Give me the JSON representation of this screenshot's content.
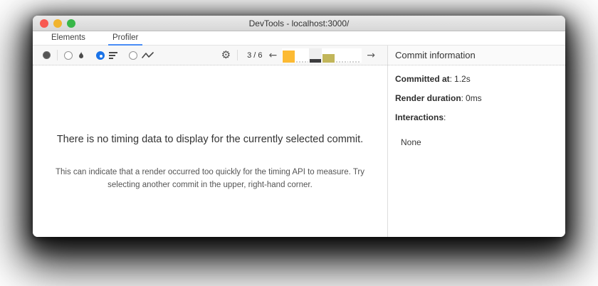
{
  "colors": {
    "accent_blue": "#1a73e8",
    "tab_underline": "#4a8df6",
    "traffic_close": "#f85a52",
    "traffic_minimize": "#f1b42e",
    "traffic_zoom": "#38b748"
  },
  "window": {
    "title": "DevTools - localhost:3000/"
  },
  "tabs": [
    {
      "label": "Elements",
      "active": false
    },
    {
      "label": "Profiler",
      "active": true
    }
  ],
  "toolbar": {
    "record_icon": "record-icon",
    "chart_modes": [
      {
        "name": "flamegraph",
        "icon": "flame-icon",
        "selected": false
      },
      {
        "name": "ranked",
        "icon": "ranked-chart-icon",
        "selected": true
      },
      {
        "name": "interactions",
        "icon": "interactions-icon",
        "selected": false
      }
    ],
    "settings_icon": "gear-icon",
    "gear_glyph": "⚙",
    "commit_position": "3 / 6",
    "prev_arrow": "←",
    "next_arrow": "→"
  },
  "commit_selector": {
    "total_commits": 6,
    "selected_commit": 3,
    "bars": [
      {
        "height_pct": 85,
        "color": "#fcba33",
        "selected": false,
        "near_zero": false
      },
      {
        "height_pct": 0,
        "color": "#d2d2d2",
        "selected": false,
        "near_zero": true
      },
      {
        "height_pct": 25,
        "color": "#3d3d3f",
        "selected": true,
        "near_zero": false
      },
      {
        "height_pct": 60,
        "color": "#c2b65a",
        "selected": false,
        "near_zero": false
      },
      {
        "height_pct": 0,
        "color": "#d2d2d2",
        "selected": false,
        "near_zero": true
      },
      {
        "height_pct": 0,
        "color": "#d2d2d2",
        "selected": false,
        "near_zero": true
      }
    ]
  },
  "main": {
    "no_data_title": "There is no timing data to display for the currently selected commit.",
    "no_data_body": "This can indicate that a render occurred too quickly for the timing API to measure. Try selecting another commit in the upper, right-hand corner."
  },
  "commit_info": {
    "title": "Commit information",
    "separator": ":",
    "rows": [
      {
        "label": "Committed at",
        "value": "1.2s"
      },
      {
        "label": "Render duration",
        "value": "0ms"
      },
      {
        "label": "Interactions",
        "value": ""
      }
    ],
    "interactions_value": "None"
  }
}
